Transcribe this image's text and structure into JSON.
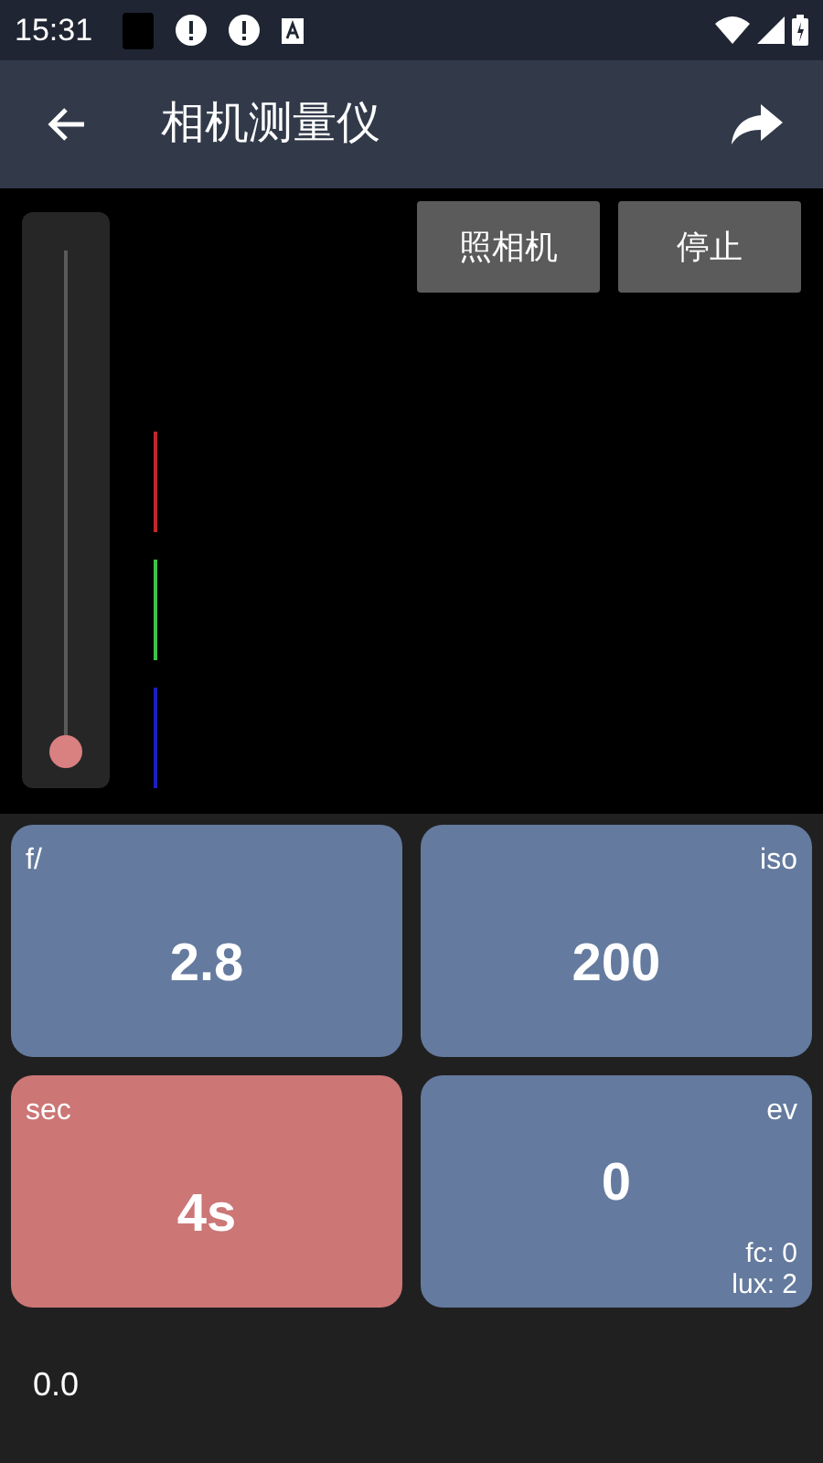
{
  "status_bar": {
    "time": "15:31"
  },
  "app_bar": {
    "title": "相机测量仪"
  },
  "preview": {
    "slider": {
      "level": 0
    },
    "channels": [
      {
        "color": "#c0272d"
      },
      {
        "color": "#3cc24a"
      },
      {
        "color": "#1a1fc0"
      }
    ],
    "buttons": [
      "照相机",
      "停止"
    ]
  },
  "tiles": [
    {
      "label": "f/",
      "value": "2.8",
      "color": "#647a9e"
    },
    {
      "label": "iso",
      "value": "200",
      "color": "#647a9e"
    },
    {
      "label": "sec",
      "value": "4s",
      "color": "#cc7676"
    },
    {
      "label": "ev",
      "value": "0",
      "color": "#647a9e",
      "extras": [
        "fc: 0",
        "lux: 2"
      ]
    }
  ],
  "footer": {
    "reading": "0.0"
  }
}
